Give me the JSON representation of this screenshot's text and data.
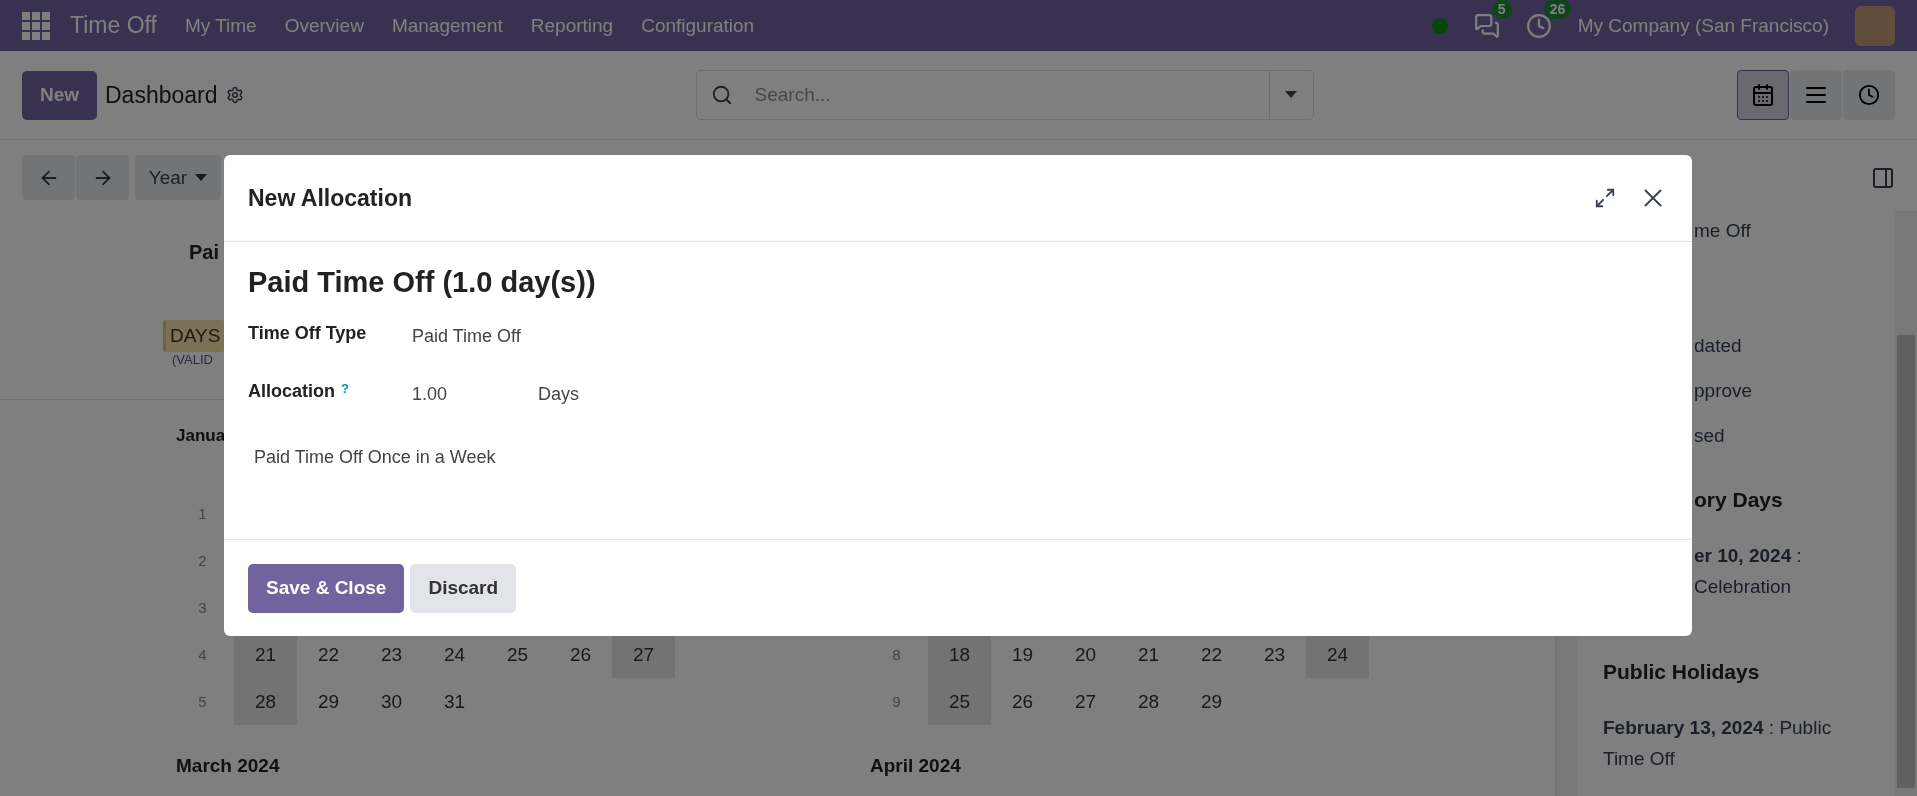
{
  "navbar": {
    "app_name": "Time Off",
    "menus": [
      "My Time",
      "Overview",
      "Management",
      "Reporting",
      "Configuration"
    ],
    "online": true,
    "messages_badge": "5",
    "activities_badge": "26",
    "company": "My Company (San Francisco)"
  },
  "control_panel": {
    "new_button": "New",
    "title": "Dashboard",
    "search": {
      "placeholder": "Search..."
    },
    "views": [
      {
        "kind": "calendar",
        "selected": true
      },
      {
        "kind": "list",
        "selected": false
      },
      {
        "kind": "activity",
        "selected": false
      }
    ]
  },
  "calendar_toolbar": {
    "range_button": "Year"
  },
  "summary_card": {
    "title": "Pai",
    "badge": "DAYS",
    "note": "(VALID"
  },
  "months": [
    {
      "title": "Janua",
      "weeks": [
        {
          "number": "1"
        },
        {
          "number": "2"
        },
        {
          "number": "3"
        },
        {
          "number": "4",
          "days": [
            "21",
            "22",
            "23",
            "24",
            "25",
            "26",
            "27"
          ]
        },
        {
          "number": "5",
          "days": [
            "28",
            "29",
            "30",
            "31"
          ]
        }
      ]
    },
    {
      "weeks": [
        {
          "number": "8",
          "days": [
            "18",
            "19",
            "20",
            "21",
            "22",
            "23",
            "24"
          ]
        },
        {
          "number": "9",
          "days": [
            "25",
            "26",
            "27",
            "28",
            "29"
          ]
        }
      ]
    }
  ],
  "next_months": [
    "March 2024",
    "April 2024"
  ],
  "sidebar": {
    "type_label": "me Off",
    "states": [
      "dated",
      "pprove",
      "sed"
    ],
    "mandatory": {
      "title": "ory Days",
      "entries": [
        {
          "lines": [
            "**er 10, 2024** :",
            "Celebration"
          ]
        }
      ]
    },
    "public_holidays": {
      "title": "Public Holidays",
      "entries": [
        {
          "text": "**February 13, 2024** : Public Time Off"
        }
      ]
    }
  },
  "modal": {
    "title": "New Allocation",
    "heading": "Paid Time Off (1.0 day(s))",
    "fields": [
      {
        "label": "Time Off Type",
        "value": "Paid Time Off"
      },
      {
        "label": "Allocation",
        "help": "?",
        "value": "1.00",
        "unit": "Days"
      }
    ],
    "note": "Paid Time Off Once in a Week",
    "buttons": [
      {
        "label": "Save & Close",
        "kind": "primary"
      },
      {
        "label": "Discard",
        "kind": "secondary"
      }
    ]
  }
}
